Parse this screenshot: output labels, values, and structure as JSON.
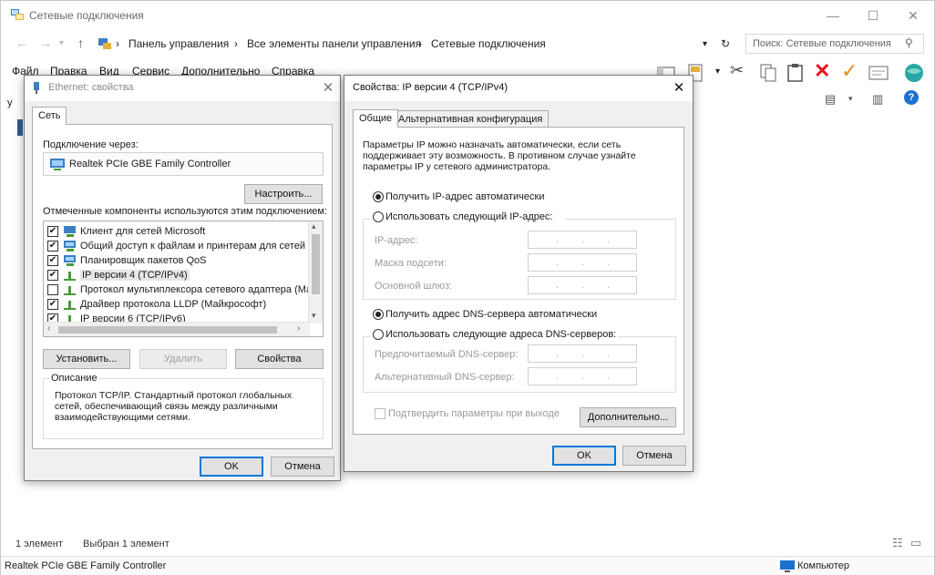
{
  "explorer": {
    "title": "Сетевые подключения",
    "breadcrumb": [
      "Панель управления",
      "Все элементы панели управления",
      "Сетевые подключения"
    ],
    "search_placeholder": "Поиск: Сетевые подключения",
    "menu": [
      "Файл",
      "Правка",
      "Вид",
      "Сервис",
      "Дополнительно",
      "Справка"
    ],
    "status_items": "1 элемент",
    "status_selected": "Выбран 1 элемент",
    "details_adapter": "Realtek PCIe GBE Family Controller",
    "details_computer": "Компьютер",
    "left_strip_letter": "у"
  },
  "eth_dialog": {
    "title": "Ethernet: свойства",
    "tab_network": "Сеть",
    "connect_using_label": "Подключение через:",
    "adapter_name": "Realtek PCIe GBE Family Controller",
    "configure_button": "Настроить...",
    "components_label": "Отмеченные компоненты используются этим подключением:",
    "components": [
      {
        "label": "Клиент для сетей Microsoft",
        "checked": true,
        "icon": "network-client-icon"
      },
      {
        "label": "Общий доступ к файлам и принтерам для сетей Mi",
        "checked": true,
        "icon": "network-service-icon"
      },
      {
        "label": "Планировщик пакетов QoS",
        "checked": true,
        "icon": "network-service-icon"
      },
      {
        "label": "IP версии 4 (TCP/IPv4)",
        "checked": true,
        "icon": "protocol-icon"
      },
      {
        "label": "Протокол мультиплексора сетевого адаптера (Май",
        "checked": false,
        "icon": "protocol-icon"
      },
      {
        "label": "Драйвер протокола LLDP (Майкрософт)",
        "checked": true,
        "icon": "protocol-icon"
      },
      {
        "label": "IP версии 6 (TCP/IPv6)",
        "checked": true,
        "icon": "protocol-icon"
      }
    ],
    "install_button": "Установить...",
    "uninstall_button": "Удалить",
    "properties_button": "Свойства",
    "description_title": "Описание",
    "description_text": "Протокол TCP/IP. Стандартный протокол глобальных сетей, обеспечивающий связь между различными взаимодействующими сетями.",
    "ok_button": "OK",
    "cancel_button": "Отмена"
  },
  "ipv4_dialog": {
    "title": "Свойства: IP версии 4 (TCP/IPv4)",
    "tab_general": "Общие",
    "tab_alternate": "Альтернативная конфигурация",
    "intro_text": "Параметры IP можно назначать автоматически, если сеть поддерживает эту возможность. В противном случае узнайте параметры IP у сетевого администратора.",
    "ip_auto_label": "Получить IP-адрес автоматически",
    "ip_manual_label": "Использовать следующий IP-адрес:",
    "ip_auto_selected": true,
    "ip_address_label": "IP-адрес:",
    "subnet_label": "Маска подсети:",
    "gateway_label": "Основной шлюз:",
    "dns_auto_label": "Получить адрес DNS-сервера автоматически",
    "dns_manual_label": "Использовать следующие адреса DNS-серверов:",
    "dns_auto_selected": true,
    "preferred_dns_label": "Предпочитаемый DNS-сервер:",
    "alternate_dns_label": "Альтернативный DNS-сервер:",
    "validate_label": "Подтвердить параметры при выходе",
    "advanced_button": "Дополнительно...",
    "ok_button": "OK",
    "cancel_button": "Отмена"
  },
  "colors": {
    "accent": "#0078d7",
    "error_red": "#e81123",
    "check_orange": "#e8891a"
  }
}
